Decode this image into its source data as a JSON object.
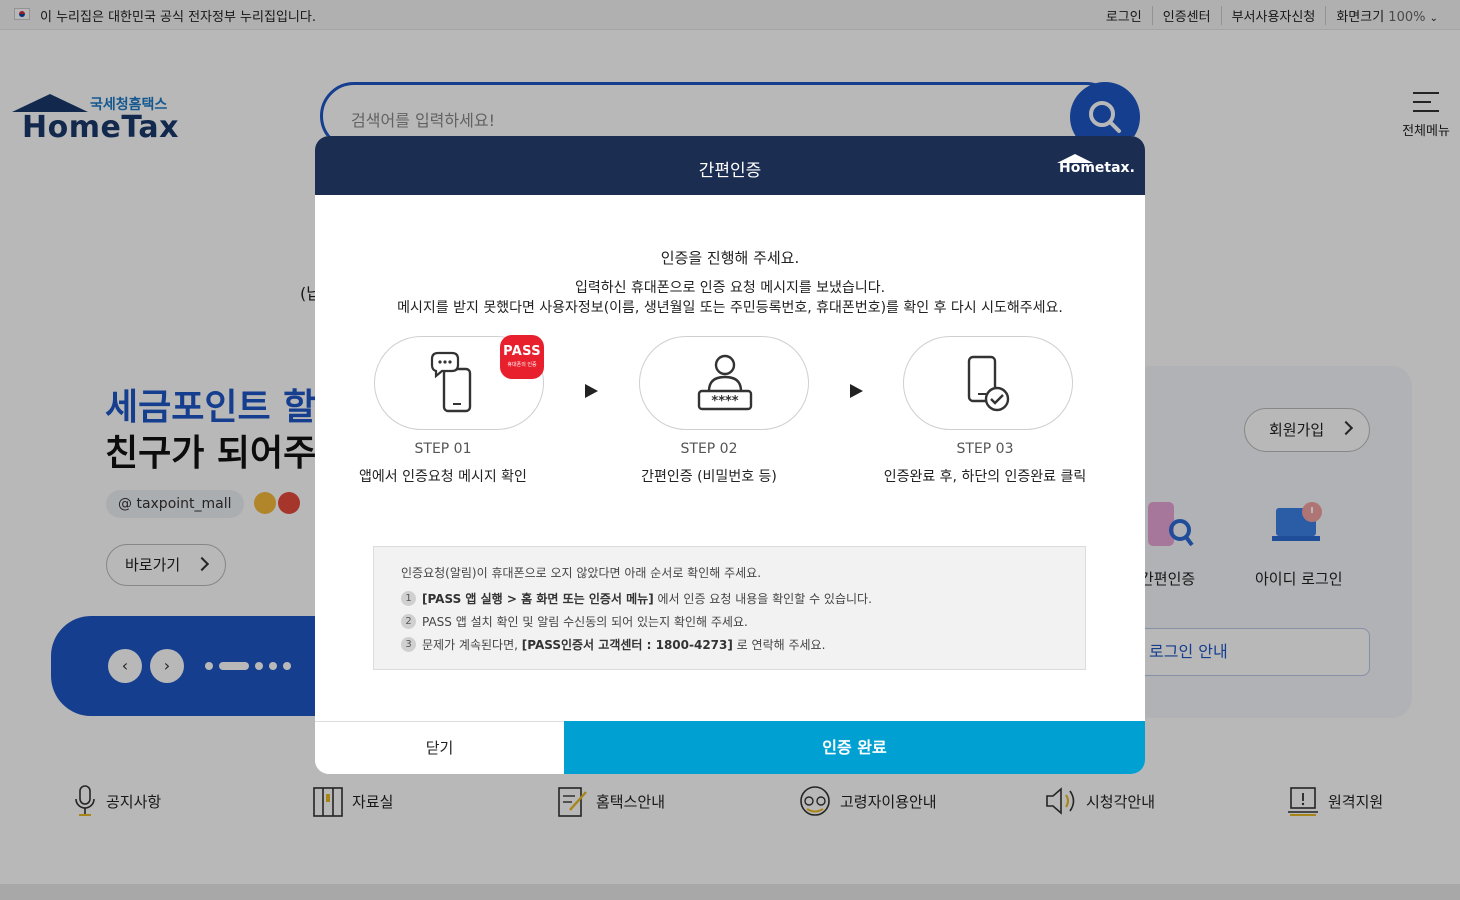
{
  "gov_banner": {
    "text": "이 누리집은 대한민국 공식 전자정부 누리집입니다.",
    "links": [
      "로그인",
      "인증센터",
      "부서사용자신청"
    ],
    "zoom_label": "화면크기",
    "zoom_value": "100%"
  },
  "header": {
    "logo_sub": "국세청홈택스",
    "logo_main": "HomeTax",
    "search_placeholder": "검색어를 입력하세요!",
    "all_menu": "전체메뉴"
  },
  "hero": {
    "paren_text": "(납",
    "title_line1": "세금포인트 할",
    "title_line2": "친구가 되어주",
    "hashtag": "@ taxpoint_mall",
    "goto_button": "바로가기"
  },
  "login_panel": {
    "signup": "회원가입",
    "simple_auth": "간편인증",
    "id_login": "아이디 로그인",
    "guide": "로그인 안내"
  },
  "bottom_nav": [
    "공지사항",
    "자료실",
    "홈택스안내",
    "고령자이용안내",
    "시청각안내",
    "원격지원"
  ],
  "modal": {
    "title": "간편인증",
    "logo_text": "Hometax.",
    "message_main": "인증을 진행해 주세요.",
    "message_line1": "입력하신 휴대폰으로 인증 요청 메시지를 보냈습니다.",
    "message_line2": "메시지를 받지 못했다면 사용자정보(이름, 생년월일 또는 주민등록번호, 휴대폰번호)를 확인 후 다시 시도해주세요.",
    "pass_badge": "PASS",
    "pass_badge_sub": "휴대폰의 인증",
    "steps": [
      {
        "num": "STEP 01",
        "desc": "앱에서 인증요청 메시지 확인"
      },
      {
        "num": "STEP 02",
        "desc": "간편인증 (비밀번호 등)"
      },
      {
        "num": "STEP 03",
        "desc": "인증완료 후, 하단의 인증완료 클릭"
      }
    ],
    "notice_title": "인증요청(알림)이 휴대폰으로 오지 않았다면 아래 순서로 확인해 주세요.",
    "notice_items": [
      {
        "n": "1",
        "bold": "[PASS 앱 실행 > 홈 화면 또는 인증서 메뉴]",
        "rest": " 에서 인증 요청 내용을 확인할 수 있습니다."
      },
      {
        "n": "2",
        "bold": "",
        "rest": "PASS 앱 설치 확인 및 알림 수신동의 되어 있는지 확인해 주세요."
      },
      {
        "n": "3",
        "pre": "문제가 계속된다면, ",
        "bold": "[PASS인증서 고객센터 : 1800-4273]",
        "rest": " 로 연락해 주세요."
      }
    ],
    "close_button": "닫기",
    "done_button": "인증 완료"
  }
}
